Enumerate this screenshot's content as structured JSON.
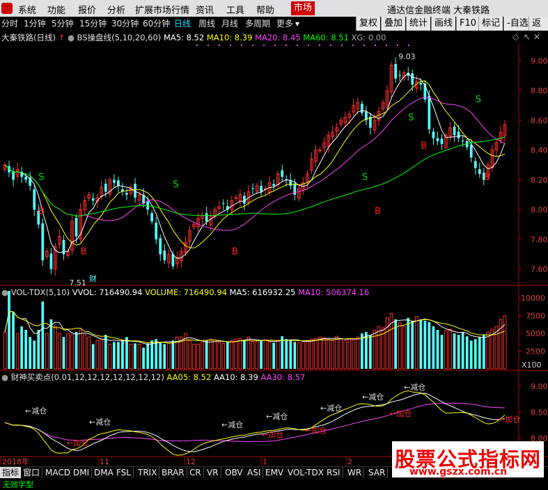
{
  "menu": {
    "items": [
      "系统",
      "功能",
      "报价",
      "分析",
      "扩展市场行情",
      "资讯",
      "工具",
      "帮助"
    ],
    "active": "市场",
    "app_title": "通达信金融终端 大秦铁路"
  },
  "toolbar": {
    "buttons": [
      "复权",
      "叠加",
      "统计",
      "画线",
      "F10",
      "标记",
      "-自选",
      "返回"
    ]
  },
  "periods": {
    "items": [
      "分时",
      "1分钟",
      "5分钟",
      "15分钟",
      "30分钟",
      "60分钟",
      "日线",
      "周线",
      "月线",
      "多周期",
      "更多"
    ],
    "selected": "日线"
  },
  "main_header": {
    "stock": "大秦铁路(日线)",
    "indicator": "BS操盘线(5,10,20,60)",
    "ma5": "MA5: 8.52",
    "ma10": "MA10: 8.39",
    "ma20": "MA20: 8.45",
    "ma60": "MA60: 8.51",
    "xg": "XG: 0.00"
  },
  "vol_header": {
    "name": "VOL-TDX(5,10)",
    "vvol": "VVOL: 716490.94",
    "volume": "VOLUME: 716490.94",
    "ma5": "MA5: 616932.25",
    "ma10": "MA10: 506374.16"
  },
  "cs_header": {
    "name": "财神买卖点(0.01,12,12,12,12,12,12,12)",
    "aa05": "AA05: 8.52",
    "aa10": "AA10: 8.39",
    "aa30": "AA30: 8.57"
  },
  "price_axis": [
    "9.00",
    "8.80",
    "8.60",
    "8.40",
    "8.20",
    "8.00",
    "7.80",
    "7.60"
  ],
  "vol_axis": [
    "10000",
    "7500",
    "5000",
    "2500"
  ],
  "vol_unit": "X100",
  "cs_axis": [
    "9.00",
    "8.50",
    "8.00"
  ],
  "date_axis": [
    "2018年",
    "11",
    "12",
    "1",
    "2"
  ],
  "annotations": {
    "high": "9.03",
    "low": "7.51",
    "cai": "财"
  },
  "signals": {
    "buy": "B",
    "sell": "S",
    "jiacang": "加仓",
    "jiancang": "减仓"
  },
  "bottom_tabs": [
    "指标",
    "窗口",
    "MACD",
    "DMI",
    "DMA",
    "FSL",
    "TRIX",
    "BRAR",
    "CR",
    "VR",
    "OBV",
    "ASI",
    "EMV",
    "VOL-TDX",
    "RSI",
    "WR",
    "SAR"
  ],
  "status": "无效字型",
  "watermark": {
    "title": "股票公式指标网",
    "url": "www.gszx.com.cn"
  },
  "colors": {
    "up": "#ff3030",
    "down": "#54ffff",
    "ma5": "#ffffff",
    "ma10": "#ffff00",
    "ma20": "#ff44ff",
    "ma60": "#00ff00"
  },
  "chart_data": [
    {
      "type": "candlestick",
      "title": "BS操盘线(5,10,20,60)",
      "ylim": [
        7.5,
        9.1
      ],
      "low": 7.51,
      "high": 9.03,
      "close_series": [
        8.3,
        8.25,
        8.2,
        8.27,
        8.22,
        8.2,
        8.16,
        8.0,
        7.9,
        7.66,
        7.72,
        7.6,
        7.75,
        7.82,
        7.7,
        7.72,
        7.92,
        7.82,
        8.0,
        8.06,
        8.1,
        8.06,
        8.08,
        8.15,
        8.12,
        8.2,
        8.18,
        8.16,
        8.12,
        8.1,
        8.15,
        8.08,
        8.1,
        8.04,
        8.0,
        7.92,
        7.8,
        7.7,
        7.66,
        7.7,
        7.62,
        7.68,
        7.72,
        7.78,
        7.86,
        7.9,
        7.94,
        7.96,
        7.92,
        7.96,
        8.0,
        8.02,
        8.04,
        8.0,
        8.06,
        8.08,
        8.1,
        8.04,
        8.12,
        8.14,
        8.16,
        8.12,
        8.14,
        8.18,
        8.16,
        8.24,
        8.22,
        8.2,
        8.16,
        8.1,
        8.14,
        8.18,
        8.24,
        8.34,
        8.4,
        8.4,
        8.45,
        8.5,
        8.52,
        8.55,
        8.6,
        8.62,
        8.64,
        8.7,
        8.72,
        8.65,
        8.6,
        8.55,
        8.6,
        8.66,
        8.72,
        8.8,
        8.97,
        8.88,
        8.9,
        8.92,
        8.9,
        8.84,
        8.86,
        8.84,
        8.74,
        8.54,
        8.48,
        8.46,
        8.44,
        8.5,
        8.55,
        8.5,
        8.48,
        8.46,
        8.42,
        8.35,
        8.28,
        8.24,
        8.2,
        8.3,
        8.4,
        8.45,
        8.52,
        8.57
      ],
      "series": [
        {
          "name": "MA5",
          "value": 8.52
        },
        {
          "name": "MA10",
          "value": 8.39
        },
        {
          "name": "MA20",
          "value": 8.45
        },
        {
          "name": "MA60",
          "value": 8.51
        }
      ]
    },
    {
      "type": "bar",
      "title": "VOL-TDX(5,10)",
      "ylim": [
        0,
        11000
      ],
      "values": [
        5200,
        11000,
        8000,
        5000,
        6000,
        5500,
        4500,
        4000,
        5500,
        9500,
        5000,
        7000,
        6000,
        5000,
        4500,
        5000,
        4800,
        5200,
        5500,
        4800,
        4500,
        3500,
        4000,
        4200,
        4800,
        3500,
        3800,
        3800,
        4000,
        4500,
        3500,
        3600,
        3500,
        3000,
        3600,
        4000,
        4200,
        3800,
        3500,
        3600,
        4000,
        4500,
        4500,
        5000,
        4000,
        3500,
        3500,
        3800,
        4000,
        4200,
        3900,
        3700,
        3600,
        3800,
        4000,
        4200,
        4300,
        4000,
        4500,
        3900,
        3800,
        4000,
        4100,
        3800,
        3700,
        4000,
        4600,
        4200,
        4000,
        3800,
        3700,
        3900,
        4000,
        4200,
        4300,
        4500,
        4400,
        4200,
        4000,
        4600,
        4200,
        4000,
        4300,
        4100,
        4500,
        5000,
        5200,
        4800,
        5500,
        6000,
        5800,
        7200,
        7800,
        7000,
        6500,
        6000,
        7200,
        6800,
        7400,
        7000,
        6800,
        6600,
        6000,
        5500,
        4800,
        5400,
        5600,
        5000,
        4800,
        5200,
        4600,
        4000,
        4200,
        4500,
        4800,
        5200,
        5600,
        6000,
        7000,
        7500
      ],
      "ma5": 616932.25,
      "ma10": 506374.16,
      "volume": 716490.94
    },
    {
      "type": "line",
      "title": "财神买卖点(0.01,12,12,12,12,12,12,12)",
      "ylim": [
        7.7,
        9.2
      ],
      "series": [
        {
          "name": "AA05",
          "value": 8.52
        },
        {
          "name": "AA10",
          "value": 8.39
        },
        {
          "name": "AA30",
          "value": 8.57
        }
      ]
    }
  ]
}
